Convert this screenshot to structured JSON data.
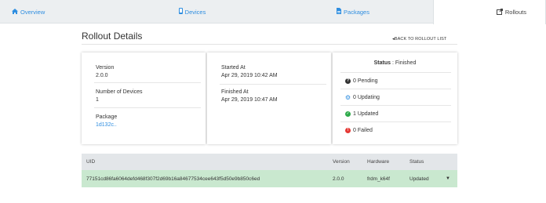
{
  "tabs": {
    "overview": "Overview",
    "devices": "Devices",
    "packages": "Packages",
    "rollouts": "Rollouts"
  },
  "page_title": "Rollout Details",
  "back_link": "BACK TO ROLLOUT LIST",
  "details": {
    "version_label": "Version",
    "version_value": "2.0.0",
    "devices_label": "Number of Devices",
    "devices_value": "1",
    "package_label": "Package",
    "package_value": "1d132c..",
    "started_label": "Started At",
    "started_value": "Apr 29, 2019 10:42 AM",
    "finished_label": "Finished At",
    "finished_value": "Apr 29, 2019 10:47 AM"
  },
  "status": {
    "label": "Status",
    "value": " : Finished",
    "pending": "0 Pending",
    "updating": "0 Updating",
    "updated": "1 Updated",
    "failed": "0 Failed"
  },
  "colors": {
    "accent": "#2f8ee0",
    "pending": "#333333",
    "updating": "#2f8ee0",
    "updated": "#2eaa4a",
    "failed": "#e53935",
    "row_highlight": "#c9e8cf"
  },
  "table": {
    "headers": {
      "uid": "UID",
      "version": "Version",
      "hardware": "Hardware",
      "status": "Status"
    },
    "rows": [
      {
        "uid": "77151cd86fa6064defd468f307f2d69b16a84677534cee643f5d50e9b850c6ed",
        "version": "2.0.0",
        "hardware": "frdm_k64f",
        "status": "Updated"
      }
    ]
  }
}
